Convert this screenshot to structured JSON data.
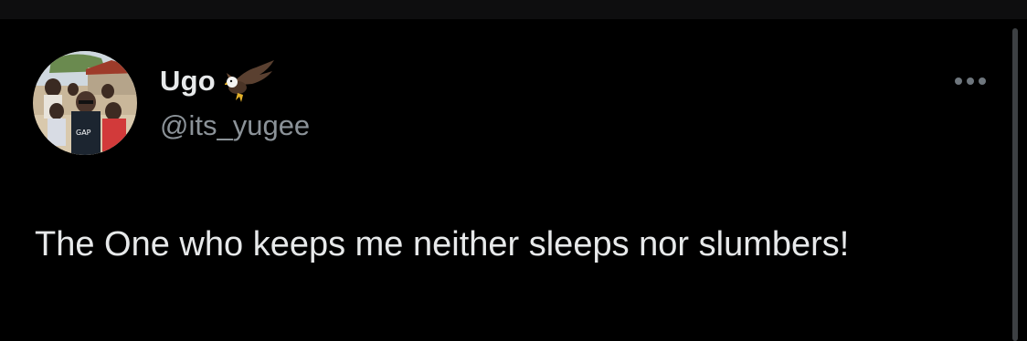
{
  "tweet": {
    "author": {
      "display_name": "Ugo",
      "handle": "@its_yugee",
      "name_emoji": "eagle-emoji",
      "avatar": "profile-photo"
    },
    "text": "The One who keeps me neither sleeps nor slumbers!",
    "more_icon": "more-horizontal-icon"
  },
  "colors": {
    "background": "#000000",
    "primary_text": "#e7e9ea",
    "secondary_text": "#8b9298",
    "icon": "#6e767d"
  }
}
